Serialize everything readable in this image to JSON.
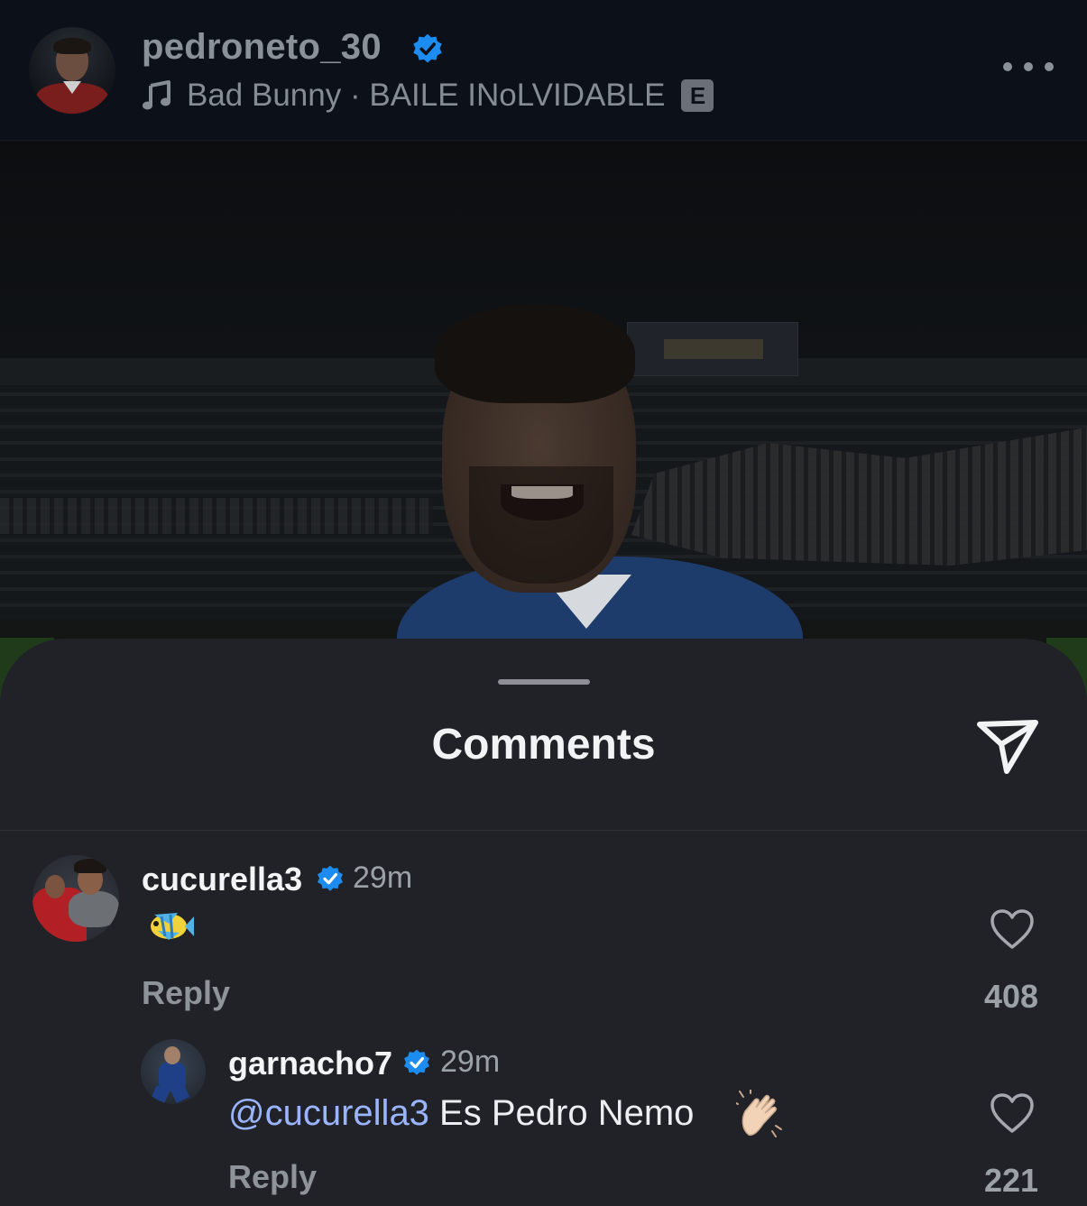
{
  "header": {
    "username": "pedroneto_30",
    "verified_icon": "verified-badge-icon",
    "music": {
      "icon": "music-note-icon",
      "artist": "Bad Bunny",
      "separator": " · ",
      "track": "BAILE INoLVIDABLE",
      "explicit_label": "E"
    },
    "more_icon": "more-horizontal-icon"
  },
  "sheet": {
    "title": "Comments",
    "share_icon": "send-icon"
  },
  "comments": [
    {
      "username": "cucurella3",
      "time": "29m",
      "text_emoji": "fish-emoji",
      "reply_label": "Reply",
      "likes": "408"
    },
    {
      "username": "garnacho7",
      "time": "29m",
      "mention": "@cucurella3",
      "text": " Es Pedro Nemo ",
      "text_emoji": "clapping-hands-emoji",
      "reply_label": "Reply",
      "likes": "221"
    }
  ],
  "colors": {
    "header_bg": "#0c1119",
    "sheet_bg": "#202227",
    "verified": "#1d8cf0",
    "mention": "#9ab4ff"
  }
}
